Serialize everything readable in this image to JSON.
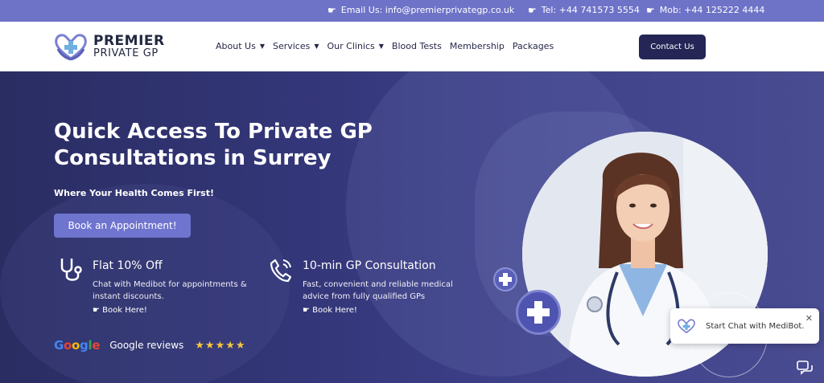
{
  "topbar": {
    "email": "Email Us: info@premierprivategp.co.uk",
    "tel": "Tel: +44 741573 5554",
    "mob": "Mob: +44 125222 4444",
    "hand_glyph": "☛"
  },
  "logo": {
    "line1": "PREMIER",
    "line2": "PRIVATE GP"
  },
  "nav": {
    "items": [
      {
        "label": "About Us",
        "dropdown": true
      },
      {
        "label": "Services",
        "dropdown": true
      },
      {
        "label": "Our Clinics",
        "dropdown": true
      },
      {
        "label": "Blood Tests",
        "dropdown": false
      },
      {
        "label": "Membership",
        "dropdown": false
      },
      {
        "label": "Packages",
        "dropdown": false
      }
    ],
    "chevron": "⌄",
    "contact_label": "Contact Us"
  },
  "hero": {
    "title": "Quick Access To Private GP Consultations in Surrey",
    "tagline": "Where Your Health Comes First!",
    "cta_label": "Book an Appointment!"
  },
  "features": [
    {
      "title": "Flat 10% Off",
      "desc": "Chat with Medibot for appointments & instant discounts.",
      "link": "☛ Book Here!",
      "icon": "stethoscope-icon"
    },
    {
      "title": "10-min GP Consultation",
      "desc": "Fast, convenient and reliable medical advice from fully qualified GPs",
      "link": "☛ Book Here!",
      "icon": "phone-call-icon"
    }
  ],
  "reviews": {
    "brand": "Google",
    "label": "Google reviews",
    "stars": "★★★★★",
    "rating": 5
  },
  "chat": {
    "text": "Start Chat with MediBot.",
    "close": "✕"
  },
  "colors": {
    "topbar": "#6e73c8",
    "navy": "#252656",
    "accent": "#6f74cf",
    "star": "#f4c53d"
  }
}
